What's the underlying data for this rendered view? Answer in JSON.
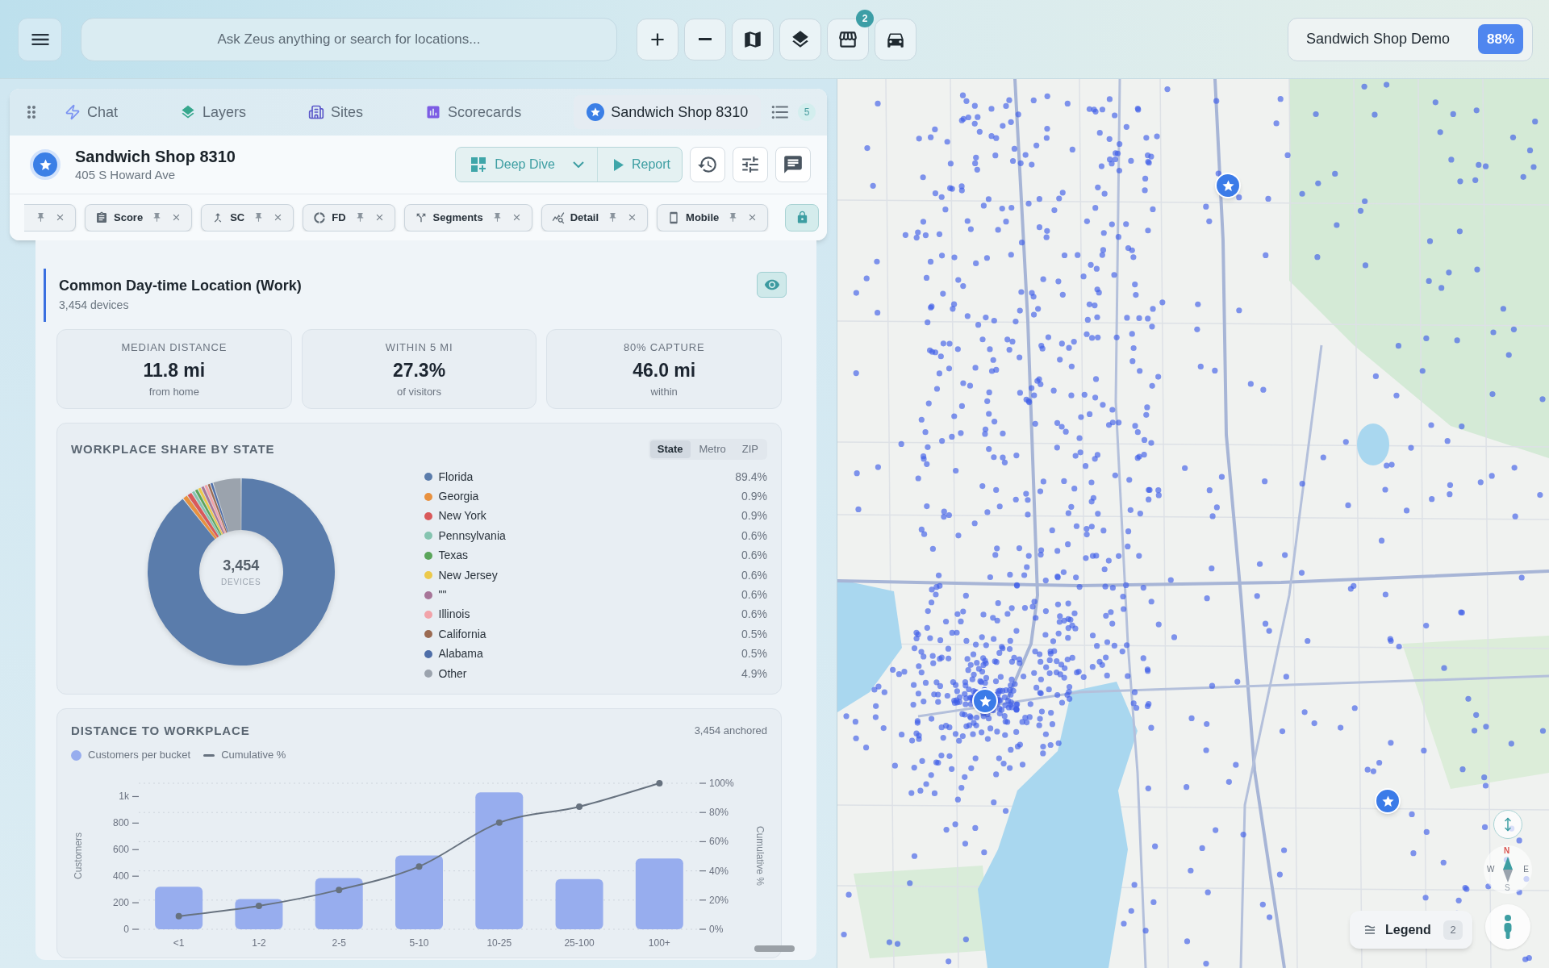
{
  "top_bar": {
    "search": {
      "placeholder": "Ask Zeus anything or search for locations..."
    },
    "tools": [
      {
        "kind": "zoom_in"
      },
      {
        "kind": "zoom_out"
      },
      {
        "kind": "map"
      },
      {
        "kind": "layers"
      },
      {
        "kind": "stores",
        "badge": "2"
      },
      {
        "kind": "car"
      }
    ],
    "project": {
      "name": "Sandwich Shop Demo",
      "score": "88%"
    }
  },
  "tabs": [
    {
      "kind": "chat",
      "label": "Chat",
      "selected": false
    },
    {
      "kind": "layers",
      "label": "Layers",
      "selected": false
    },
    {
      "kind": "sites",
      "label": "Sites",
      "selected": false
    },
    {
      "kind": "scorecards",
      "label": "Scorecards",
      "selected": false
    },
    {
      "kind": "site",
      "label": "Sandwich Shop 8310",
      "selected": true
    }
  ],
  "open_tabs_count": "5",
  "site": {
    "name": "Sandwich Shop 8310",
    "address": "405 S Howard Ave",
    "actions": {
      "deep_dive": "Deep Dive",
      "report": "Report"
    }
  },
  "chips": [
    {
      "kind": "clipped"
    },
    {
      "kind": "score",
      "label": "Score"
    },
    {
      "kind": "sc",
      "label": "SC"
    },
    {
      "kind": "fd",
      "label": "FD"
    },
    {
      "kind": "segments",
      "label": "Segments"
    },
    {
      "kind": "detail",
      "label": "Detail"
    },
    {
      "kind": "mobile",
      "label": "Mobile"
    }
  ],
  "section": {
    "title": "Common Day-time Location (Work)",
    "subtitle": "3,454 devices",
    "visible": true
  },
  "metrics": [
    {
      "label": "MEDIAN DISTANCE",
      "value": "11.8 mi",
      "note": "from home"
    },
    {
      "label": "WITHIN 5 MI",
      "value": "27.3%",
      "note": "of visitors"
    },
    {
      "label": "80% CAPTURE",
      "value": "46.0 mi",
      "note": "within"
    }
  ],
  "workplace_share": {
    "title": "WORKPLACE SHARE BY STATE",
    "views": [
      {
        "label": "State",
        "selected": true
      },
      {
        "label": "Metro",
        "selected": false
      },
      {
        "label": "ZIP",
        "selected": false
      }
    ],
    "center": {
      "value": "3,454",
      "label": "DEVICES"
    },
    "chart_data": {
      "type": "donut",
      "categories": [
        "Florida",
        "Georgia",
        "New York",
        "Pennsylvania",
        "Texas",
        "New Jersey",
        "\"\"",
        "Illinois",
        "California",
        "Alabama",
        "Other"
      ],
      "values": [
        89.4,
        0.9,
        0.9,
        0.6,
        0.6,
        0.6,
        0.6,
        0.6,
        0.5,
        0.5,
        4.9
      ],
      "value_labels": [
        "89.4%",
        "0.9%",
        "0.9%",
        "0.6%",
        "0.6%",
        "0.6%",
        "0.6%",
        "0.6%",
        "0.5%",
        "0.5%",
        "4.9%"
      ],
      "colors": [
        "#5a7cab",
        "#e8913f",
        "#d9595a",
        "#85c4b0",
        "#5aa55a",
        "#ecc94b",
        "#a77598",
        "#f2a3a9",
        "#9b6b52",
        "#4e6ea8",
        "#9ba3ad"
      ]
    }
  },
  "distance": {
    "title": "DISTANCE TO WORKPLACE",
    "summary": "3,454 anchored",
    "chart_data": {
      "type": "bar",
      "grid": true,
      "categories": [
        "<1",
        "1-2",
        "2-5",
        "5-10",
        "10-25",
        "25-100",
        "100+"
      ],
      "ylabel": "Customers",
      "ylim": [
        0,
        1100
      ],
      "yticks": [
        0,
        200,
        400,
        600,
        800,
        {
          "value": 1000,
          "label": "1k"
        }
      ],
      "y2label": "Cumulative %",
      "y2lim": [
        0,
        100
      ],
      "y2ticks": [
        {
          "value": 0,
          "label": "0%"
        },
        {
          "value": 20,
          "label": "20%"
        },
        {
          "value": 40,
          "label": "40%"
        },
        {
          "value": 60,
          "label": "60%"
        },
        {
          "value": 80,
          "label": "80%"
        },
        {
          "value": 100,
          "label": "100%"
        }
      ],
      "series": [
        {
          "name": "Customers per bucket",
          "type": "bar",
          "color": "#97adee",
          "values": [
            320,
            228,
            386,
            556,
            1031,
            378,
            533
          ]
        },
        {
          "name": "Cumulative %",
          "type": "line",
          "axis": "y2",
          "marker": true,
          "color": "#67727f",
          "values": [
            9,
            16,
            27,
            43,
            73,
            84,
            100
          ]
        }
      ]
    }
  },
  "map": {
    "legend": {
      "label": "Legend",
      "count": "2"
    },
    "compass": {
      "north": "N",
      "east": "E",
      "south": "S",
      "west": "W"
    }
  }
}
